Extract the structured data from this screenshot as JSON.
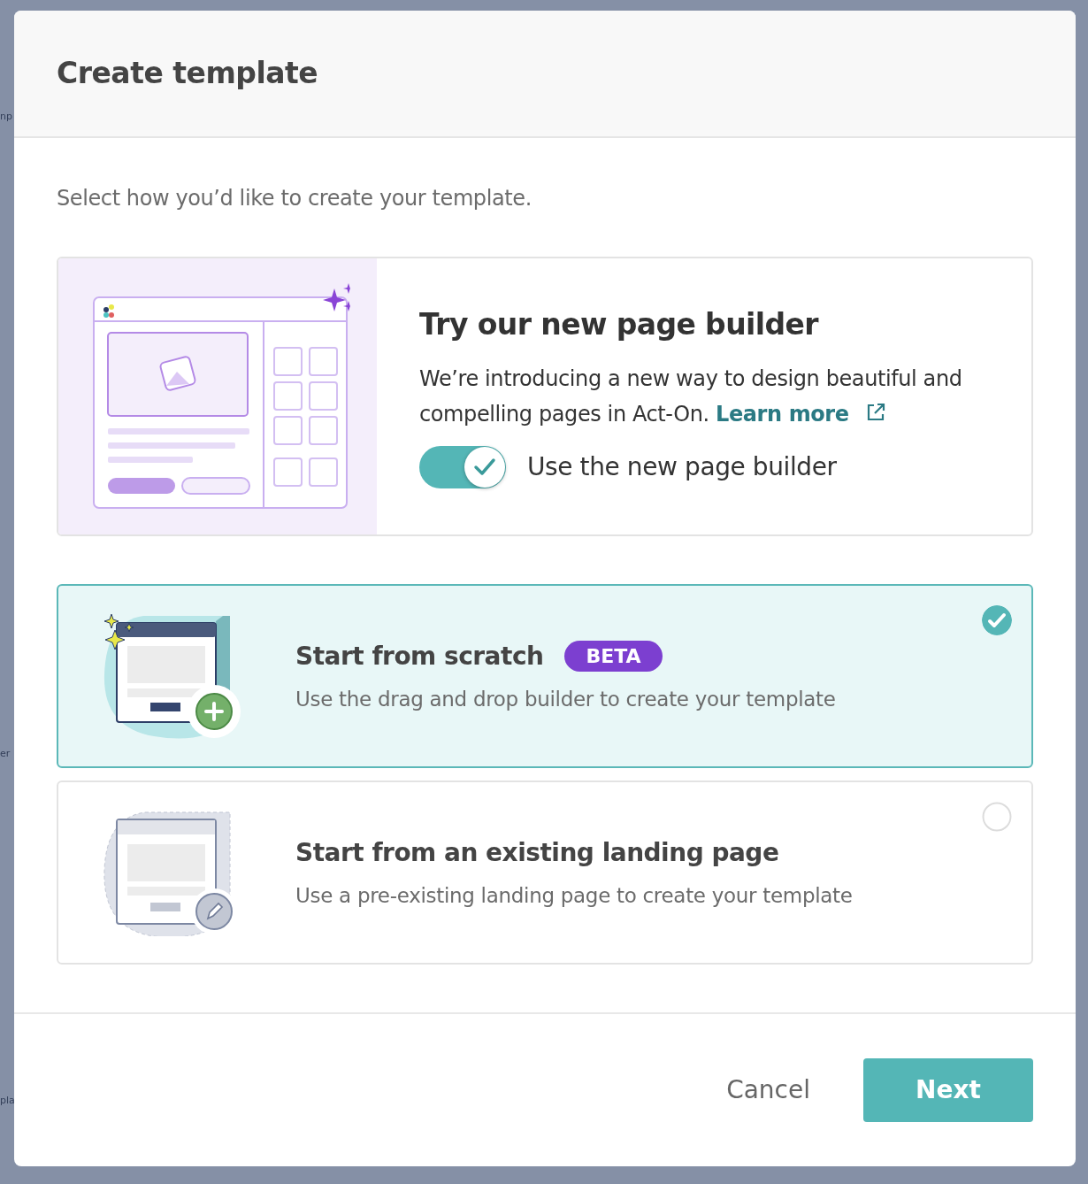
{
  "background_fragments": [
    "np",
    "er",
    "pla"
  ],
  "dialog": {
    "title": "Create template"
  },
  "intro": "Select how you’d like to create your template.",
  "promo": {
    "title": "Try our new page builder",
    "text": "We’re introducing a new way to design beautiful and compelling pages in Act-On.",
    "link": "Learn more",
    "toggle": {
      "label": "Use the new page builder",
      "on": true
    }
  },
  "options": [
    {
      "kind": "scratch",
      "title": "Start from scratch",
      "badge": "BETA",
      "description": "Use the drag and drop builder to create your template",
      "selected": true
    },
    {
      "kind": "existing",
      "title": "Start from an existing landing page",
      "description": "Use a pre-existing landing page to create your template",
      "selected": false
    }
  ],
  "buttons": {
    "cancel": "Cancel",
    "next": "Next"
  }
}
